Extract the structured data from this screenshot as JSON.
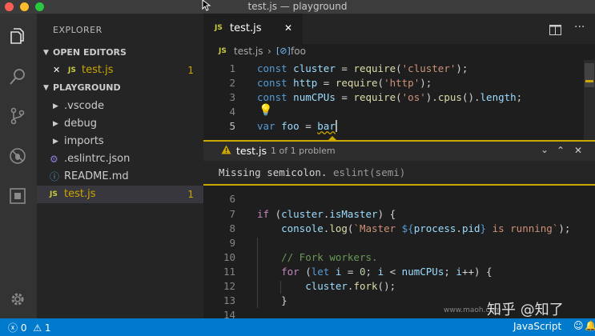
{
  "window": {
    "title": "test.js — playground"
  },
  "sidebar": {
    "header": "EXPLORER",
    "open_editors": {
      "title": "OPEN EDITORS",
      "items": [
        {
          "close": "✕",
          "icon": "JS",
          "name": "test.js",
          "badge": "1"
        }
      ]
    },
    "playground": {
      "title": "PLAYGROUND",
      "items": [
        {
          "kind": "folder",
          "name": ".vscode"
        },
        {
          "kind": "folder",
          "name": "debug"
        },
        {
          "kind": "folder",
          "name": "imports"
        },
        {
          "kind": "file",
          "icon": "gear-icon",
          "name": ".eslintrc.json"
        },
        {
          "kind": "file",
          "icon": "info-icon",
          "name": "README.md"
        },
        {
          "kind": "file",
          "icon": "JS",
          "name": "test.js",
          "badge": "1"
        }
      ]
    }
  },
  "editor": {
    "tab": {
      "icon": "JS",
      "label": "test.js",
      "close": "✕"
    },
    "breadcrumb": {
      "file_icon": "JS",
      "file": "test.js",
      "symbol": "foo"
    },
    "lines_top": [
      "1",
      "2",
      "3",
      "4",
      "5"
    ],
    "lines_bottom": [
      "6",
      "7",
      "8",
      "9",
      "10",
      "11",
      "12",
      "13",
      "14"
    ]
  },
  "peek": {
    "file": "test.js",
    "count": "1 of 1 problem",
    "message": "Missing semicolon.",
    "source": "eslint(semi)"
  },
  "statusbar": {
    "errors": "0",
    "warnings": "1",
    "language": "JavaScript"
  },
  "watermark": {
    "text": "知乎 @知了",
    "small": "www.maoh.com"
  },
  "colors": {
    "activitybar": "#333333",
    "sidebar": "#252526",
    "editor": "#1e1e1e",
    "statusbar": "#007acc",
    "warning": "#cca700"
  }
}
